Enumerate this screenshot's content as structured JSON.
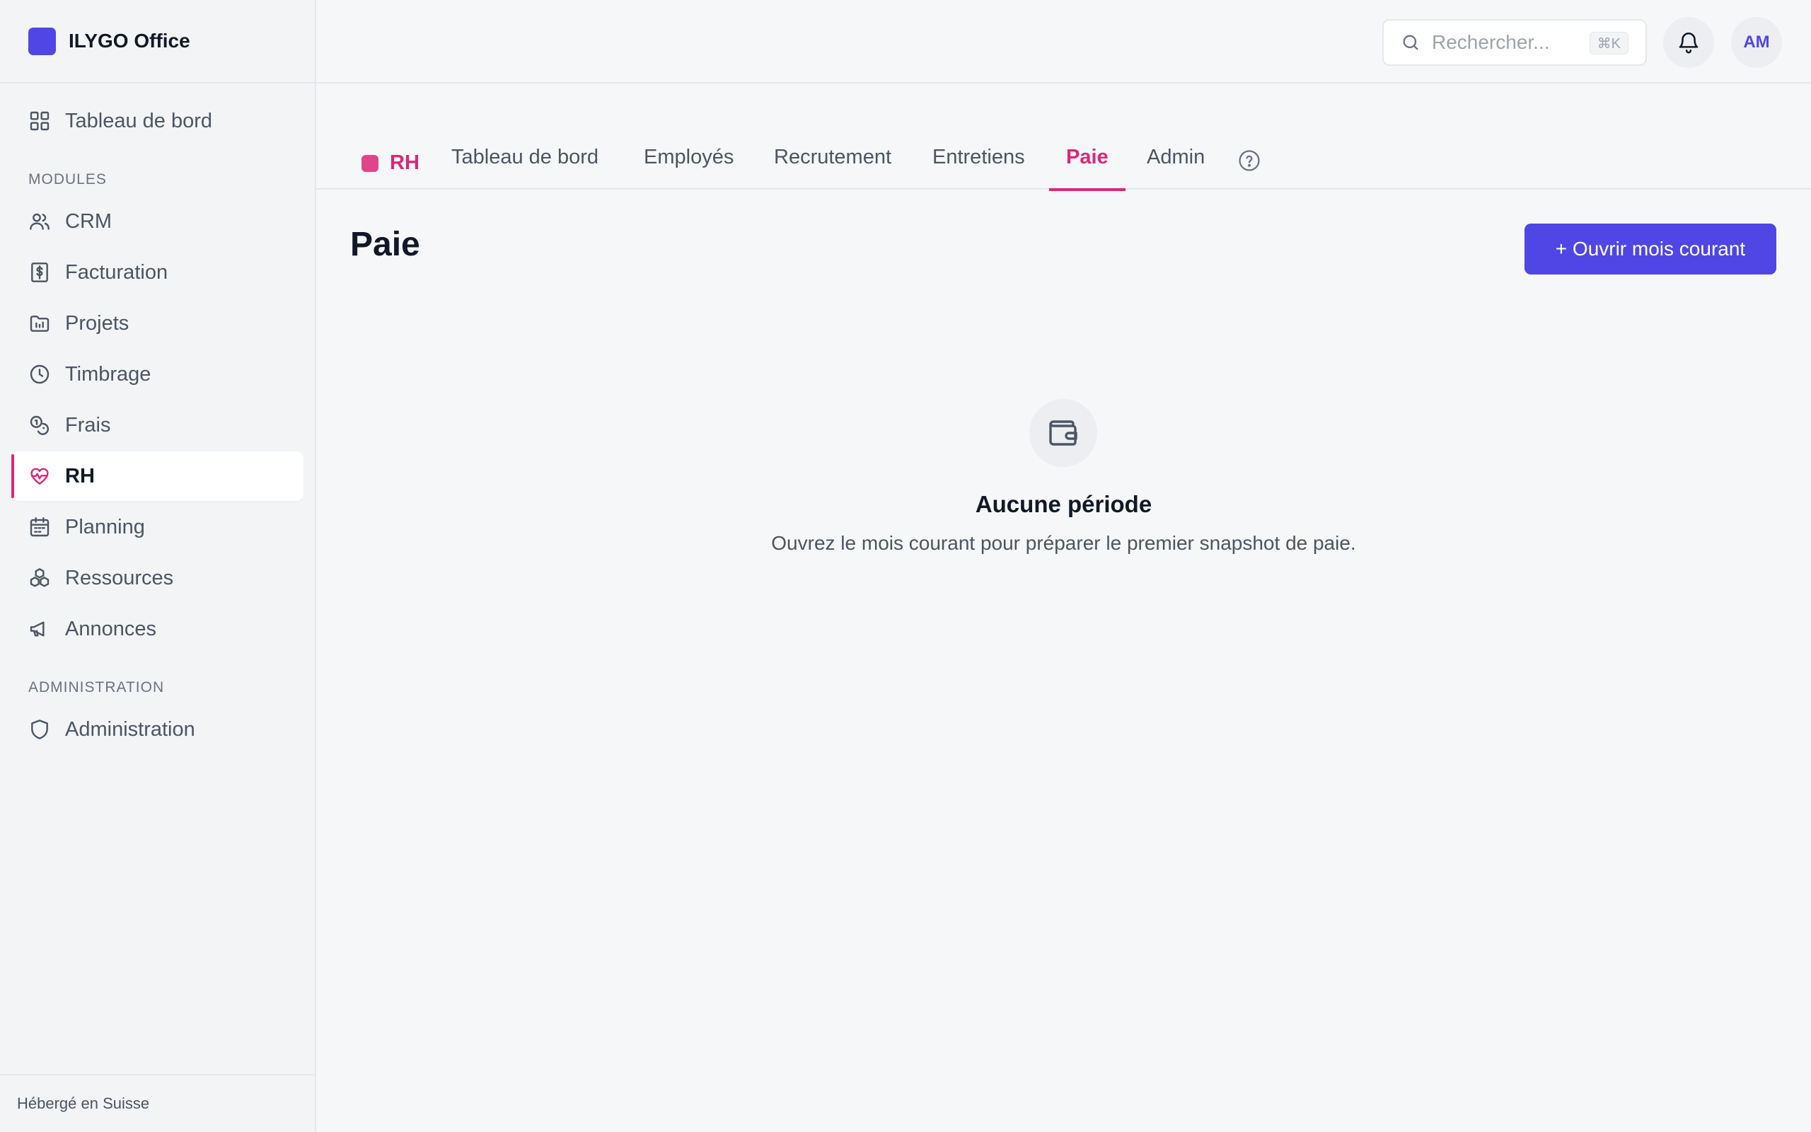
{
  "app": {
    "name": "ILYGO Office",
    "brand_color": "#4f46e5"
  },
  "sidebar": {
    "dashboard_label": "Tableau de bord",
    "modules_heading": "MODULES",
    "modules": [
      {
        "label": "CRM",
        "icon": "users-icon"
      },
      {
        "label": "Facturation",
        "icon": "receipt-dollar-icon"
      },
      {
        "label": "Projets",
        "icon": "folder-chart-icon"
      },
      {
        "label": "Timbrage",
        "icon": "clock-icon"
      },
      {
        "label": "Frais",
        "icon": "coins-icon"
      },
      {
        "label": "RH",
        "icon": "heart-pulse-icon",
        "active": true
      },
      {
        "label": "Planning",
        "icon": "calendar-icon"
      },
      {
        "label": "Ressources",
        "icon": "boxes-icon"
      },
      {
        "label": "Annonces",
        "icon": "megaphone-icon"
      }
    ],
    "admin_heading": "ADMINISTRATION",
    "admin_label": "Administration",
    "footer": "Hébergé en Suisse"
  },
  "topbar": {
    "search_placeholder": "Rechercher...",
    "search_shortcut": "⌘K",
    "avatar_initials": "AM"
  },
  "module_nav": {
    "module_name": "RH",
    "module_color": "#db2777",
    "tabs": [
      "Tableau de bord",
      "Employés",
      "Recrutement",
      "Entretiens",
      "Paie",
      "Admin"
    ],
    "active_tab": "Paie"
  },
  "page": {
    "title": "Paie",
    "primary_action": "+ Ouvrir mois courant",
    "empty_title": "Aucune période",
    "empty_description": "Ouvrez le mois courant pour préparer le premier snapshot de paie."
  }
}
